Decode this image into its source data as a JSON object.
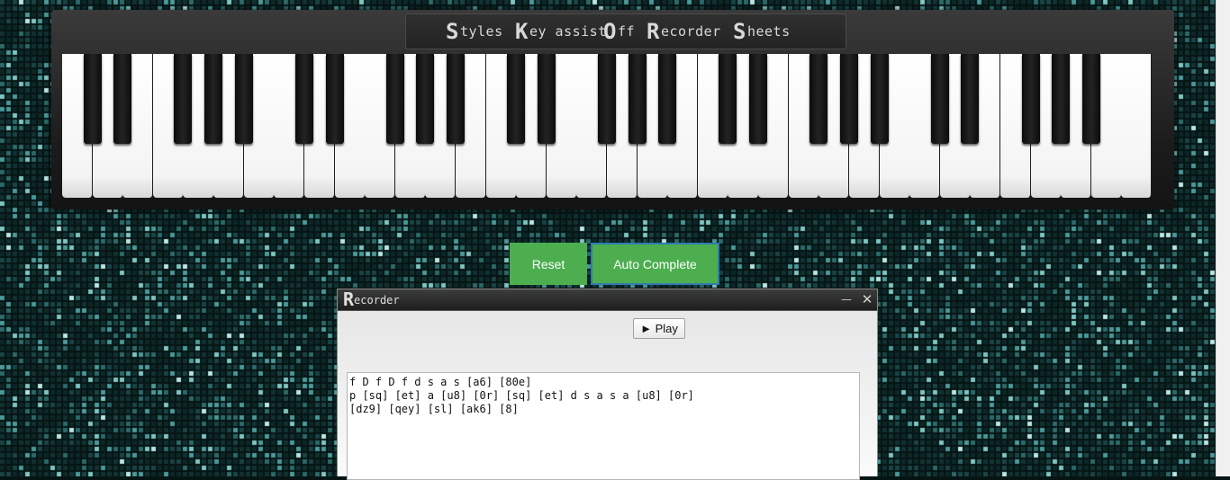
{
  "menu": {
    "items": [
      {
        "cap": "S",
        "rest": "tyles"
      },
      {
        "cap": "K",
        "rest": "ey assist"
      },
      {
        "cap": "O",
        "rest": "ff"
      },
      {
        "cap": "R",
        "rest": "ecorder"
      },
      {
        "cap": "S",
        "rest": "heets"
      }
    ]
  },
  "piano": {
    "white_key_count": 36,
    "black_keys_pattern": [
      1,
      1,
      0,
      1,
      1,
      1,
      0
    ]
  },
  "controls": {
    "reset_label": "Reset",
    "auto_complete_label": "Auto Complete"
  },
  "recorder": {
    "title_cap": "R",
    "title_rest": "ecorder",
    "minimize_label": "—",
    "close_label": "✕",
    "play_label": "► Play",
    "sheet_lines": [
      "f D f D f d s a s [a6] [80e]",
      "p [sq] [et] a [u8] [0r] [sq] [et] d s a s a [u8] [0r]",
      "[dz9] [qey] [sl] [ak6] [8]"
    ]
  },
  "colors": {
    "background": "#061414",
    "button_green": "#4cae4f",
    "button_focus_border": "#2f7bb0"
  }
}
